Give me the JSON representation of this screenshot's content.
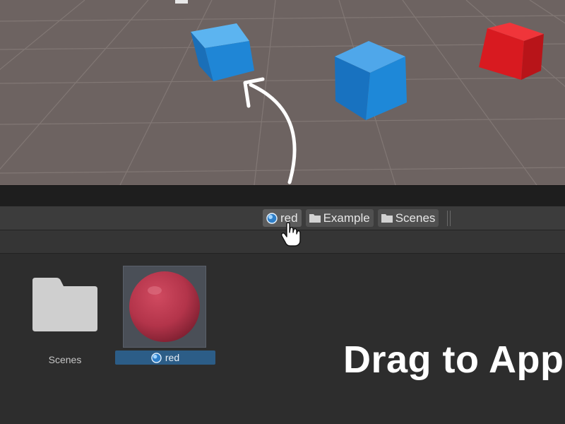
{
  "breadcrumb": {
    "items": [
      {
        "label": "red",
        "icon": "material-sphere-icon"
      },
      {
        "label": "Example",
        "icon": "folder-icon"
      },
      {
        "label": "Scenes",
        "icon": "folder-icon"
      }
    ]
  },
  "assets": {
    "items": [
      {
        "label": "Scenes",
        "icon": "folder-icon",
        "selected": false
      },
      {
        "label": "red",
        "icon": "material-sphere-icon",
        "selected": true
      }
    ]
  },
  "overlay": {
    "caption": "Drag to App"
  },
  "colors": {
    "scene_background": "#6d6361",
    "blue_cube": "#1e88d8",
    "red_cube": "#e01e23",
    "material_red": "#b3344a",
    "selection_blue": "#2c5d87"
  }
}
